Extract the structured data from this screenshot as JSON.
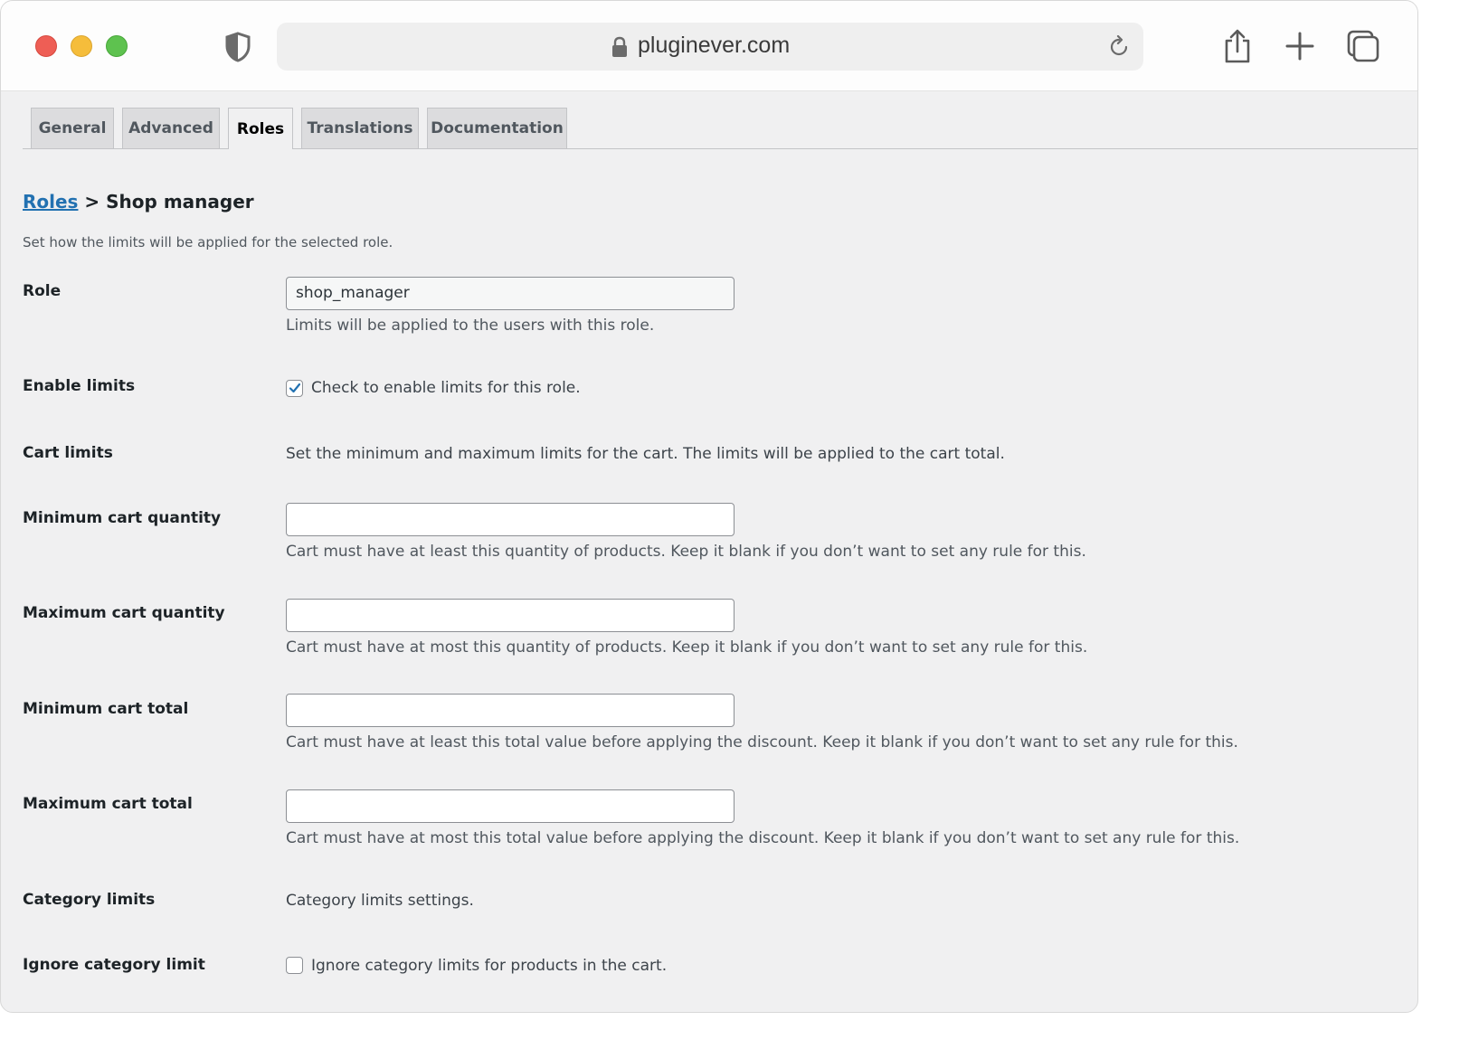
{
  "browser": {
    "url": "pluginever.com",
    "icons": [
      "close-window-icon",
      "minimize-icon",
      "zoom-icon",
      "privacy-shield-icon",
      "lock-icon",
      "reload-icon",
      "share-icon",
      "new-tab-icon",
      "tab-overview-icon"
    ]
  },
  "tabs": [
    {
      "label": "General",
      "active": false
    },
    {
      "label": "Advanced",
      "active": false
    },
    {
      "label": "Roles",
      "active": true
    },
    {
      "label": "Translations",
      "active": false
    },
    {
      "label": "Documentation",
      "active": false
    }
  ],
  "breadcrumb": {
    "parent": "Roles",
    "separator": " > ",
    "current": "Shop manager"
  },
  "intro": "Set how the limits will be applied for the selected role.",
  "fields": {
    "role": {
      "label": "Role",
      "value": "shop_manager",
      "help": "Limits will be applied to the users with this role."
    },
    "enable_limits": {
      "label": "Enable limits",
      "checked": true,
      "text": "Check to enable limits for this role."
    },
    "cart_limits": {
      "label": "Cart limits",
      "text": "Set the minimum and maximum limits for the cart. The limits will be applied to the cart total."
    },
    "min_cart_qty": {
      "label": "Minimum cart quantity",
      "value": "",
      "help": "Cart must have at least this quantity of products. Keep it blank if you don’t want to set any rule for this."
    },
    "max_cart_qty": {
      "label": "Maximum cart quantity",
      "value": "",
      "help": "Cart must have at most this quantity of products. Keep it blank if you don’t want to set any rule for this."
    },
    "min_cart_total": {
      "label": "Minimum cart total",
      "value": "",
      "help": "Cart must have at least this total value before applying the discount. Keep it blank if you don’t want to set any rule for this."
    },
    "max_cart_total": {
      "label": "Maximum cart total",
      "value": "",
      "help": "Cart must have at most this total value before applying the discount. Keep it blank if you don’t want to set any rule for this."
    },
    "category_limits": {
      "label": "Category limits",
      "text": "Category limits settings."
    },
    "ignore_category": {
      "label": "Ignore category limit",
      "checked": false,
      "text": "Ignore category limits for products in the cart."
    }
  },
  "colors": {
    "accent": "#2271b1",
    "background": "#f0f0f1"
  }
}
